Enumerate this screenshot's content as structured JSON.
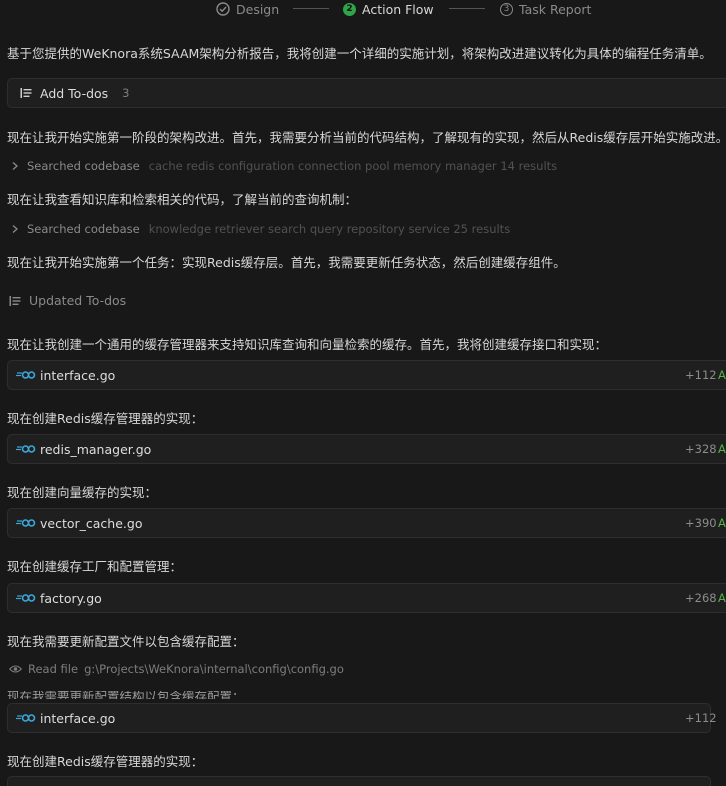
{
  "stepper": {
    "steps": [
      {
        "number": "1",
        "label": "Design"
      },
      {
        "number": "2",
        "label": "Action Flow"
      },
      {
        "number": "3",
        "label": "Task Report"
      }
    ]
  },
  "feed": {
    "intro": "基于您提供的WeKnora系统SAAM架构分析报告，我将创建一个详细的实施计划，将架构改进建议转化为具体的编程任务清单。",
    "add_todos": {
      "label": "Add To-dos",
      "count": "3"
    },
    "msg1": "现在让我开始实施第一阶段的架构改进。首先，我需要分析当前的代码结构，了解现有的实现，然后从Redis缓存层开始实施改进。",
    "search1": {
      "label": "Searched codebase",
      "query": "cache redis configuration connection pool memory manager 14 results"
    },
    "msg2": "现在让我查看知识库和检索相关的代码，了解当前的查询机制：",
    "search2": {
      "label": "Searched codebase",
      "query": "knowledge retriever search query repository service 25 results"
    },
    "msg3": "现在让我开始实施第一个任务：实现Redis缓存层。首先，我需要更新任务状态，然后创建缓存组件。",
    "updated_todos": "Updated To-dos",
    "msg4": "现在让我创建一个通用的缓存管理器来支持知识库查询和向量检索的缓存。首先，我将创建缓存接口和实现：",
    "file1": {
      "name": "interface.go",
      "diff": "+112",
      "added": "A"
    },
    "msg5": "现在创建Redis缓存管理器的实现：",
    "file2": {
      "name": "redis_manager.go",
      "diff": "+328",
      "added": "A"
    },
    "msg6": "现在创建向量缓存的实现：",
    "file3": {
      "name": "vector_cache.go",
      "diff": "+390",
      "added": "A"
    },
    "msg7": "现在创建缓存工厂和配置管理：",
    "file4": {
      "name": "factory.go",
      "diff": "+268",
      "added": "A"
    },
    "msg8": "现在我需要更新配置文件以包含缓存配置：",
    "read_file": {
      "label": "Read file",
      "path": "g:\\Projects\\WeKnora\\internal\\config\\config.go"
    },
    "msg_overlap": "现在我需要更新配置结构以包含缓存配置：",
    "file5": {
      "name": "interface.go",
      "diff": "+112"
    },
    "msg9": "现在创建Redis缓存管理器的实现："
  },
  "colors": {
    "background": "#181818",
    "card": "#1f1f1f",
    "active_step": "#2fa54a",
    "added": "#59b24a",
    "go_icon": "#3aa8d8"
  },
  "icons": {
    "done_step": "check-circle-icon",
    "todo": "list-icon",
    "search_expand": "chevron-right-icon",
    "read_file": "eye-icon",
    "file": "go-file-icon"
  }
}
